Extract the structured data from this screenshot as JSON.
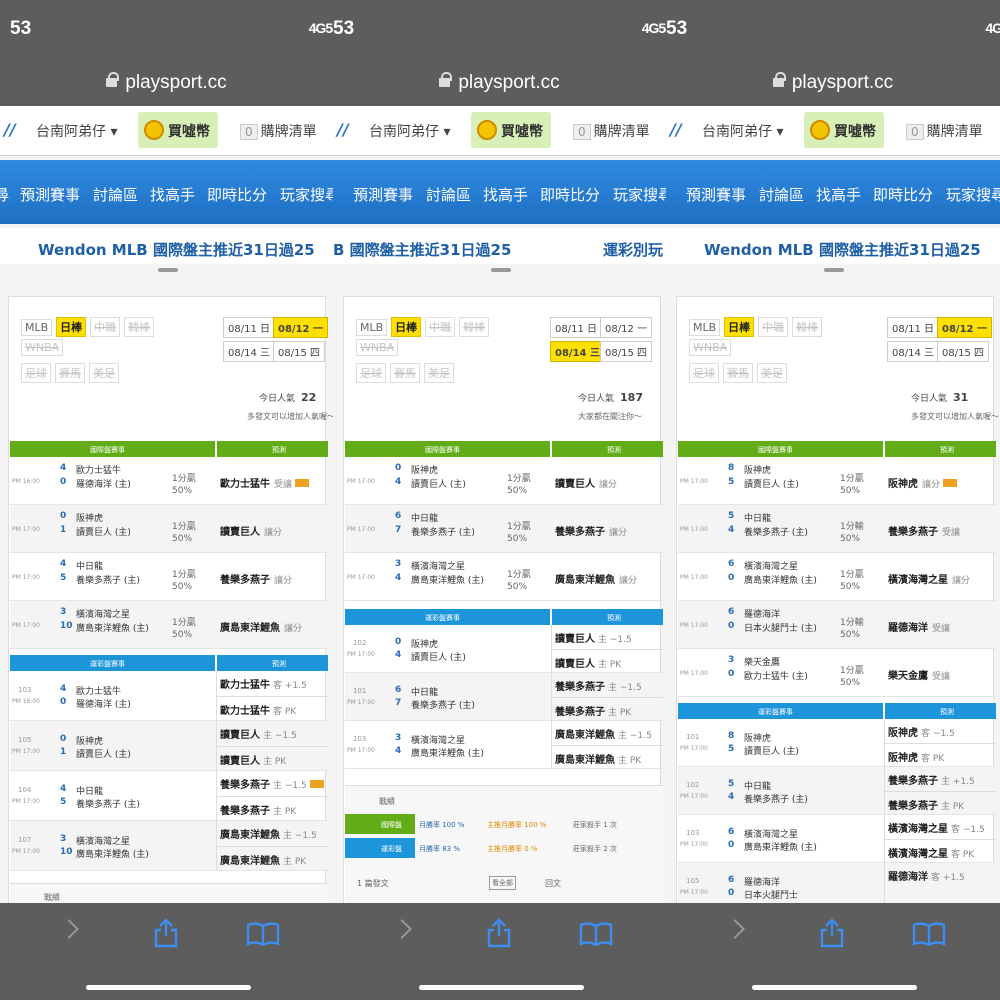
{
  "status": {
    "panel1_time": "53",
    "panel2_time": "53",
    "panel3_time": "53",
    "signal": "4G53",
    "signal3": "4G"
  },
  "browser": {
    "url": "playsport.cc"
  },
  "nav": {
    "user": "台南阿弟仔 ▾",
    "coins": "買噓幣",
    "cart_count": "0",
    "cart": "購牌清單"
  },
  "menu": [
    "預測賽事",
    "討論區",
    "找高手",
    "即時比分",
    "玩家搜尋"
  ],
  "menu_cut": {
    "p1_start": "尋",
    "p3_end": "尋"
  },
  "marquee": {
    "p1": "Wendon MLB 國際盤主推近31日過25",
    "p2a": "B 國際盤主推近31日過25",
    "p2b": "運彩別玩",
    "p3": "Wendon MLB 國際盤主推近31日過25"
  },
  "tags": {
    "mlb": "MLB",
    "npb": "日棒",
    "cpbl": "中職",
    "kbo": "韓棒",
    "wnba": "WNBA",
    "soccer": "足球",
    "horse": "賽馬",
    "golf": "美足"
  },
  "panels": [
    {
      "dates": [
        "08/11 日",
        "08/12 一",
        "08/14 三",
        "08/15 四"
      ],
      "selected": 1,
      "popularity_label": "今日人氣",
      "popularity": "22",
      "hint": "多發文可以增加人氣喔～",
      "intl_header": {
        "title": "國際盤賽事",
        "pred": "預測"
      },
      "intl": [
        {
          "time": "PM 16:00",
          "s1": "4",
          "t1": "歐力士猛牛",
          "s2": "0",
          "t2": "羅德海洋 (主)",
          "odds1": "1分贏",
          "odds2": "50%",
          "pred": "歐力士猛牛",
          "pred_type": "受讓",
          "badge": true
        },
        {
          "time": "PM 17:00",
          "s1": "0",
          "t1": "阪神虎",
          "s2": "1",
          "t2": "讀賣巨人 (主)",
          "odds1": "1分贏",
          "odds2": "50%",
          "pred": "讀賣巨人",
          "pred_type": "讓分"
        },
        {
          "time": "PM 17:00",
          "s1": "4",
          "t1": "中日龍",
          "s2": "5",
          "t2": "養樂多燕子 (主)",
          "odds1": "1分贏",
          "odds2": "50%",
          "pred": "養樂多燕子",
          "pred_type": "讓分"
        },
        {
          "time": "PM 17:00",
          "s1": "3",
          "t1": "橫濱海灣之星",
          "s2": "10",
          "t2": "廣島東洋鯉魚 (主)",
          "odds1": "1分贏",
          "odds2": "50%",
          "pred": "廣島東洋鯉魚",
          "pred_type": "讓分"
        }
      ],
      "lottery_header": {
        "title": "運彩盤賽事",
        "pred": "預測"
      },
      "lottery": [
        {
          "no": "103",
          "time": "PM 16:00",
          "s1": "4",
          "t1": "歐力士猛牛",
          "s2": "0",
          "t2": "羅德海洋 (主)",
          "p1": "歐力士猛牛",
          "p1t": "客 +1.5",
          "p2": "歐力士猛牛",
          "p2t": "客 PK"
        },
        {
          "no": "105",
          "time": "PM 17:00",
          "s1": "0",
          "t1": "阪神虎",
          "s2": "1",
          "t2": "讀賣巨人 (主)",
          "p1": "讀賣巨人",
          "p1t": "主 −1.5",
          "p2": "讀賣巨人",
          "p2t": "主 PK"
        },
        {
          "no": "104",
          "time": "PM 17:00",
          "s1": "4",
          "t1": "中日龍",
          "s2": "5",
          "t2": "養樂多燕子 (主)",
          "p1": "養樂多燕子",
          "p1t": "主 −1.5",
          "p2": "養樂多燕子",
          "p2t": "主 PK",
          "badge": true
        },
        {
          "no": "107",
          "time": "PM 17:00",
          "s1": "3",
          "t1": "橫濱海灣之星",
          "s2": "10",
          "t2": "廣島東洋鯉魚 (主)",
          "p1": "廣島東洋鯉魚",
          "p1t": "主 −1.5",
          "p2": "廣島東洋鯉魚",
          "p2t": "主 PK"
        }
      ],
      "record_label": "戰績"
    },
    {
      "dates": [
        "08/11 日",
        "08/12 一",
        "08/14 三",
        "08/15 四"
      ],
      "selected": 2,
      "popularity_label": "今日人氣",
      "popularity": "187",
      "hint": "大家都在關注你～",
      "intl_header": {
        "title": "國際盤賽事",
        "pred": "預測"
      },
      "intl": [
        {
          "time": "PM 17:00",
          "s1": "0",
          "t1": "阪神虎",
          "s2": "4",
          "t2": "讀賣巨人 (主)",
          "odds1": "1分贏",
          "odds2": "50%",
          "pred": "讀賣巨人",
          "pred_type": "讓分"
        },
        {
          "time": "PM 17:00",
          "s1": "6",
          "t1": "中日龍",
          "s2": "7",
          "t2": "養樂多燕子 (主)",
          "odds1": "1分贏",
          "odds2": "50%",
          "pred": "養樂多燕子",
          "pred_type": "讓分"
        },
        {
          "time": "PM 17:00",
          "s1": "3",
          "t1": "橫濱海灣之星",
          "s2": "4",
          "t2": "廣島東洋鯉魚 (主)",
          "odds1": "1分贏",
          "odds2": "50%",
          "pred": "廣島東洋鯉魚",
          "pred_type": "讓分"
        }
      ],
      "lottery_header": {
        "title": "運彩盤賽事",
        "pred": "預測"
      },
      "lottery": [
        {
          "no": "102",
          "time": "PM 17:00",
          "s1": "0",
          "t1": "阪神虎",
          "s2": "4",
          "t2": "讀賣巨人 (主)",
          "p1": "讀賣巨人",
          "p1t": "主 −1.5",
          "p2": "讀賣巨人",
          "p2t": "主 PK"
        },
        {
          "no": "101",
          "time": "PM 17:00",
          "s1": "6",
          "t1": "中日龍",
          "s2": "7",
          "t2": "養樂多燕子 (主)",
          "p1": "養樂多燕子",
          "p1t": "主 −1.5",
          "p2": "養樂多燕子",
          "p2t": "主 PK"
        },
        {
          "no": "103",
          "time": "PM 17:00",
          "s1": "3",
          "t1": "橫濱海灣之星",
          "s2": "4",
          "t2": "廣島東洋鯉魚 (主)",
          "p1": "廣島東洋鯉魚",
          "p1t": "主 −1.5",
          "p2": "廣島東洋鯉魚",
          "p2t": "主 PK"
        }
      ],
      "record_label": "戰績",
      "records": [
        {
          "type": "國際盤",
          "rate": "月勝率 100 %",
          "main": "主推月勝率 100 %",
          "streak": "莊家殺手 1 次"
        },
        {
          "type": "運彩盤",
          "rate": "月勝率 83 %",
          "main": "主推月勝率 0 %",
          "streak": "莊家殺手 2 次"
        }
      ],
      "posts_label": "1 篇發文",
      "posts_all": "看全部",
      "reply_label": "回文"
    },
    {
      "dates": [
        "08/11 日",
        "08/12 一",
        "08/14 三",
        "08/15 四"
      ],
      "selected": 1,
      "popularity_label": "今日人氣",
      "popularity": "31",
      "hint": "多發文可以增加人氣喔～",
      "intl_header": {
        "title": "國際盤賽事",
        "pred": "預測"
      },
      "intl": [
        {
          "time": "PM 17:00",
          "s1": "8",
          "t1": "阪神虎",
          "s2": "5",
          "t2": "讀賣巨人 (主)",
          "odds1": "1分贏",
          "odds2": "50%",
          "pred": "阪神虎",
          "pred_type": "讓分",
          "badge": true
        },
        {
          "time": "PM 17:00",
          "s1": "5",
          "t1": "中日龍",
          "s2": "4",
          "t2": "養樂多燕子 (主)",
          "odds1": "1分輸",
          "odds2": "50%",
          "pred": "養樂多燕子",
          "pred_type": "受讓"
        },
        {
          "time": "PM 17:00",
          "s1": "6",
          "t1": "橫濱海灣之星",
          "s2": "0",
          "t2": "廣島東洋鯉魚 (主)",
          "odds1": "1分贏",
          "odds2": "50%",
          "pred": "橫濱海灣之星",
          "pred_type": "讓分"
        },
        {
          "time": "PM 17:00",
          "s1": "6",
          "t1": "羅德海洋",
          "s2": "0",
          "t2": "日本火腿鬥士 (主)",
          "odds1": "1分輸",
          "odds2": "50%",
          "pred": "羅德海洋",
          "pred_type": "受讓"
        },
        {
          "time": "PM 17:00",
          "s1": "3",
          "t1": "樂天金鷹",
          "s2": "0",
          "t2": "歐力士猛牛 (主)",
          "odds1": "1分贏",
          "odds2": "50%",
          "pred": "樂天金鷹",
          "pred_type": "受讓"
        }
      ],
      "lottery_header": {
        "title": "運彩盤賽事",
        "pred": "預測"
      },
      "lottery": [
        {
          "no": "101",
          "time": "PM 17:00",
          "s1": "8",
          "t1": "阪神虎",
          "s2": "5",
          "t2": "讀賣巨人 (主)",
          "p1": "阪神虎",
          "p1t": "客 −1.5",
          "p2": "阪神虎",
          "p2t": "客 PK"
        },
        {
          "no": "102",
          "time": "PM 17:00",
          "s1": "5",
          "t1": "中日龍",
          "s2": "4",
          "t2": "養樂多燕子 (主)",
          "p1": "養樂多燕子",
          "p1t": "主 +1.5",
          "p2": "養樂多燕子",
          "p2t": "主 PK"
        },
        {
          "no": "103",
          "time": "PM 17:00",
          "s1": "6",
          "t1": "橫濱海灣之星",
          "s2": "0",
          "t2": "廣島東洋鯉魚 (主)",
          "p1": "橫濱海灣之星",
          "p1t": "客 −1.5",
          "p2": "橫濱海灣之星",
          "p2t": "客 PK"
        },
        {
          "no": "105",
          "time": "PM 17:00",
          "s1": "6",
          "t1": "羅德海洋",
          "s2": "0",
          "t2": "日本火腿鬥士",
          "p1": "羅德海洋",
          "p1t": "客 +1.5",
          "p2": "",
          "p2t": ""
        }
      ]
    }
  ],
  "colors": {
    "bar": "#5d5d5d",
    "blue_nav": "#2f8be0",
    "green": "#62ad17",
    "blue_head": "#1d95db",
    "highlight": "#ffe000"
  }
}
